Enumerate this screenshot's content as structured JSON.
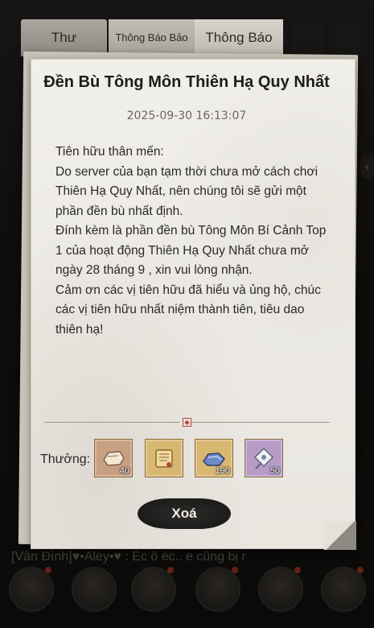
{
  "tabs": [
    {
      "label": "Thư"
    },
    {
      "label": "Thông Báo Bảo Trì"
    },
    {
      "label": "Thông Báo"
    }
  ],
  "mail": {
    "title": "Đền Bù Tông Môn Thiên Hạ Quy Nhất",
    "date": "2025-09-30 16:13:07",
    "body": "Tiên hữu thân mến:\nDo server của bạn tạm thời chưa mở cách chơi Thiên Hạ Quy Nhất, nên chúng tôi sẽ gửi một phần đền bù nhất định.\nĐính kèm là phần đền bù Tông Môn Bí Cảnh Top 1 của hoạt động Thiên Hạ Quy Nhất chưa mở ngày 28 tháng 9 , xin vui lòng nhận.\nCảm ơn các vị tiên hữu đã hiểu và ủng hộ, chúc các vị tiên hữu nhất niệm thành tiên, tiêu dao thiên hạ!",
    "reward_label": "Thưởng:",
    "rewards": [
      {
        "icon": "stone-icon",
        "count": "40"
      },
      {
        "icon": "scroll-book-icon",
        "count": ""
      },
      {
        "icon": "blue-ore-icon",
        "count": "190"
      },
      {
        "icon": "fan-token-icon",
        "count": "50"
      }
    ],
    "delete_label": "Xoá"
  },
  "chat": {
    "line": "[Vân Đình]♥•Aley•♥ :  Éc ô éc.. e cũng bị r"
  },
  "colors": {
    "paper": "#efece6",
    "reward_gold": "#d8b770",
    "reward_purple": "#b69bc8",
    "reward_orange": "#c99f82",
    "accent_red": "#b5473b"
  }
}
